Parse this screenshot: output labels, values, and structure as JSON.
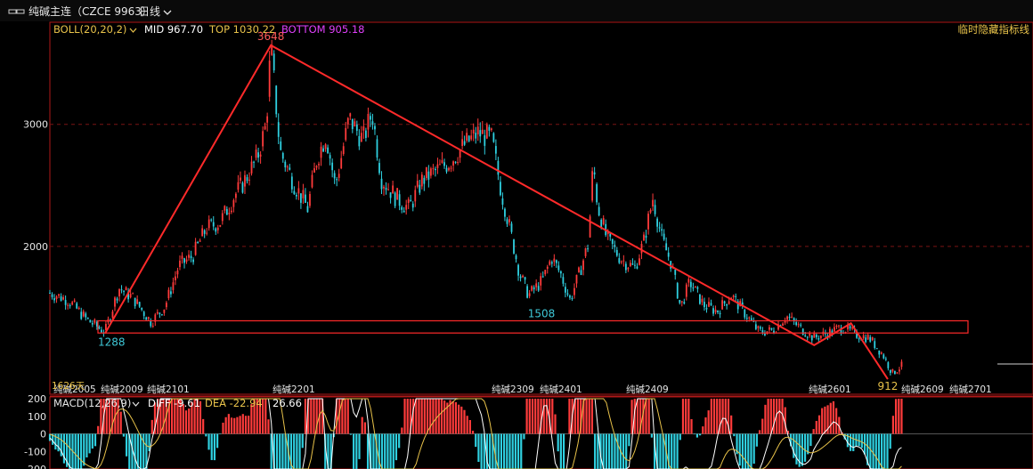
{
  "header": {
    "title": "纯碱主连（CZCE 9963）",
    "period": "日线",
    "right_label": "临时隐藏指标线"
  },
  "boll": {
    "label": "BOLL(20,20,2)",
    "mid_label": "MID 967.70",
    "top_label": "TOP 1030.22",
    "bottom_label": "BOTTOM 905.18",
    "colors": {
      "label": "#e8c24a",
      "mid": "#ffffff",
      "top": "#e8c24a",
      "bottom": "#e040fb"
    }
  },
  "macd": {
    "label": "MACD(12,26,9)",
    "diff_label": "DIFF -9.61",
    "dea_label": "DEA -22.94",
    "value_label": "26.66",
    "ticks": [
      {
        "v": 200,
        "label": "200"
      },
      {
        "v": 100,
        "label": "100"
      },
      {
        "v": 0,
        "label": "0"
      },
      {
        "v": -100,
        "label": "-100"
      },
      {
        "v": -200,
        "label": "-200"
      }
    ]
  },
  "chart_data": {
    "type": "candlestick",
    "y_ticks": [
      {
        "v": 3000,
        "label": "3000"
      },
      {
        "v": 2000,
        "label": "2000"
      }
    ],
    "ylim": [
      810,
      3800
    ],
    "contract_labels": [
      "纯碱2005",
      "纯碱2009",
      "纯碱2101",
      "纯碱2201",
      "纯碱2309",
      "纯碱2401",
      "纯碱2409",
      "纯碱2601",
      "纯碱2609",
      "纯碱2701"
    ],
    "days_label": "1626天",
    "annotations": [
      {
        "label": "3648",
        "color": "#ff5a5a"
      },
      {
        "label": "1288",
        "color": "#3ec7d6"
      },
      {
        "label": "1508",
        "color": "#3ec7d6"
      },
      {
        "label": "912",
        "color": "#e8c24a"
      }
    ],
    "trend_points": [
      {
        "x": 0.06,
        "y": 1288
      },
      {
        "x": 0.24,
        "y": 3648
      },
      {
        "x": 0.83,
        "y": 1190
      },
      {
        "x": 0.87,
        "y": 1370
      },
      {
        "x": 0.91,
        "y": 912
      }
    ],
    "price_path": [
      [
        0.0,
        1620
      ],
      [
        0.02,
        1560
      ],
      [
        0.04,
        1400
      ],
      [
        0.06,
        1300
      ],
      [
        0.075,
        1660
      ],
      [
        0.09,
        1580
      ],
      [
        0.11,
        1380
      ],
      [
        0.125,
        1510
      ],
      [
        0.14,
        1840
      ],
      [
        0.155,
        1920
      ],
      [
        0.17,
        2150
      ],
      [
        0.185,
        2200
      ],
      [
        0.2,
        2410
      ],
      [
        0.21,
        2520
      ],
      [
        0.225,
        2720
      ],
      [
        0.235,
        3000
      ],
      [
        0.24,
        3648
      ],
      [
        0.25,
        2780
      ],
      [
        0.265,
        2520
      ],
      [
        0.28,
        2310
      ],
      [
        0.29,
        2720
      ],
      [
        0.3,
        2920
      ],
      [
        0.31,
        2490
      ],
      [
        0.325,
        3050
      ],
      [
        0.34,
        2870
      ],
      [
        0.35,
        3100
      ],
      [
        0.36,
        2560
      ],
      [
        0.375,
        2410
      ],
      [
        0.39,
        2310
      ],
      [
        0.405,
        2550
      ],
      [
        0.42,
        2620
      ],
      [
        0.435,
        2700
      ],
      [
        0.45,
        2830
      ],
      [
        0.465,
        2930
      ],
      [
        0.48,
        2880
      ],
      [
        0.49,
        2460
      ],
      [
        0.5,
        2130
      ],
      [
        0.51,
        1780
      ],
      [
        0.52,
        1600
      ],
      [
        0.535,
        1720
      ],
      [
        0.545,
        1910
      ],
      [
        0.555,
        1770
      ],
      [
        0.565,
        1560
      ],
      [
        0.575,
        1780
      ],
      [
        0.585,
        2030
      ],
      [
        0.59,
        2690
      ],
      [
        0.595,
        2330
      ],
      [
        0.605,
        2060
      ],
      [
        0.62,
        1900
      ],
      [
        0.635,
        1820
      ],
      [
        0.645,
        2040
      ],
      [
        0.655,
        2400
      ],
      [
        0.665,
        2050
      ],
      [
        0.675,
        1860
      ],
      [
        0.685,
        1500
      ],
      [
        0.695,
        1710
      ],
      [
        0.71,
        1520
      ],
      [
        0.725,
        1470
      ],
      [
        0.74,
        1600
      ],
      [
        0.755,
        1450
      ],
      [
        0.77,
        1300
      ],
      [
        0.785,
        1310
      ],
      [
        0.8,
        1430
      ],
      [
        0.815,
        1330
      ],
      [
        0.83,
        1250
      ],
      [
        0.845,
        1290
      ],
      [
        0.86,
        1340
      ],
      [
        0.875,
        1280
      ],
      [
        0.89,
        1250
      ],
      [
        0.905,
        1110
      ],
      [
        0.915,
        960
      ],
      [
        0.925,
        1020
      ]
    ]
  }
}
